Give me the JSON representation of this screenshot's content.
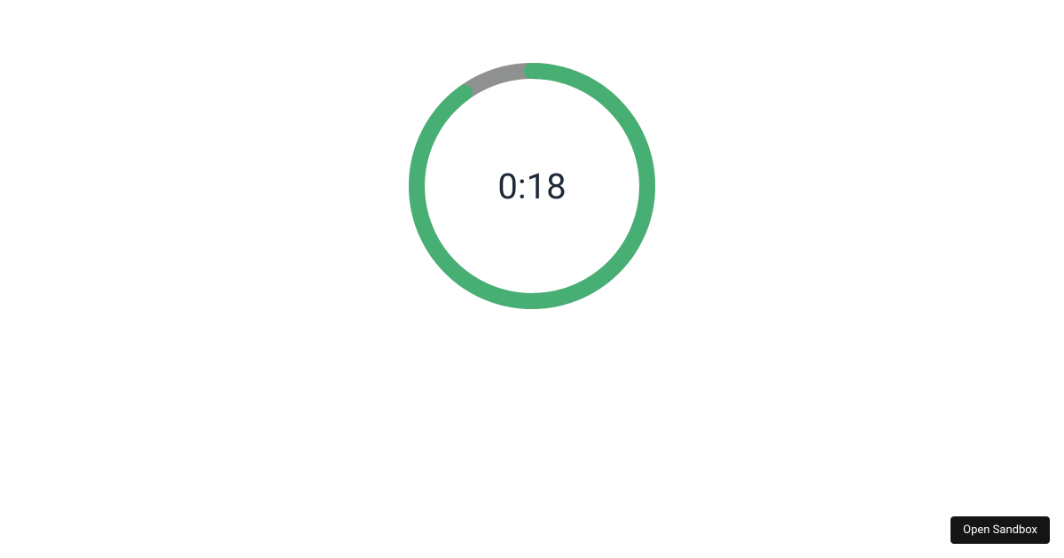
{
  "timer": {
    "display": "0:18",
    "progress_fraction": 0.9,
    "colors": {
      "track": "#8f9090",
      "progress": "#47af73",
      "text": "#1f2937"
    }
  },
  "sandbox": {
    "button_label": "Open Sandbox"
  }
}
